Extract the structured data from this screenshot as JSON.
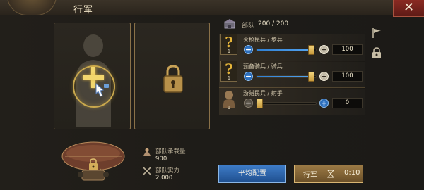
{
  "header": {
    "title": "行军",
    "close_icon": "close-x-icon"
  },
  "hero_slot": {
    "action_icon": "add-hero-plus-icon",
    "pointer_icon": "tap-hand-icon"
  },
  "locked_slot": {
    "icon": "padlock-icon"
  },
  "airship": {
    "capacity_label": "部队承载量",
    "capacity_value": "900",
    "power_label": "部队实力",
    "power_value": "2,000"
  },
  "troops": {
    "label": "部队",
    "value": "200 / 200",
    "units": [
      {
        "name": "火枪民兵 / 步兵",
        "tier": "1",
        "count": "100",
        "fill": 0.95,
        "minus_active": true,
        "plus_style": "light"
      },
      {
        "name": "预备骑兵 / 骑兵",
        "tier": "1",
        "count": "100",
        "fill": 0.95,
        "minus_active": true,
        "plus_style": "light"
      },
      {
        "name": "游猎民兵 / 射手",
        "tier": "1",
        "count": "0",
        "fill": 0.0,
        "minus_active": false,
        "plus_style": "blue"
      }
    ]
  },
  "buttons": {
    "average": "平均配置",
    "march": "行军",
    "march_time": "0:10"
  },
  "colors": {
    "accent_gold": "#c9a84d",
    "slider_blue": "#2e7fd4",
    "close_red": "#8a2a22"
  }
}
